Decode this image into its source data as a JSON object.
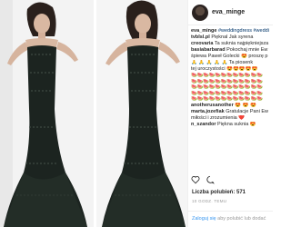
{
  "post": {
    "username": "eva_minge",
    "likes": "Liczba polubień: 571",
    "date": "10 GODZ. TEMU"
  },
  "comments": [
    {
      "user": "eva_minge",
      "text": "#weddingdress #weddi"
    },
    {
      "user": "tvbIsl.pl",
      "text": "Pięknal Jak syrena"
    },
    {
      "user": "creovaria",
      "text": "Ta suknia najpiękniejsza"
    },
    {
      "user": "basiabarbarad",
      "text": "Pokochaj mnie Ew"
    },
    {
      "user": "",
      "text": "śpiewa Paweł Golecki 😍 proszę p"
    },
    {
      "user": "",
      "text": "🙏 🙏 🙏 🙏 🙏 Ta piosenk"
    },
    {
      "user": "",
      "text": "tej uroczystości 😍😍😍😍😍"
    }
  ],
  "emoji_rows": [
    "🍉🍉🍉🍉🍉🍉🍉🍉🍉🍉🍉🍉",
    "🍉🍉🍉🍉🍉🍉🍉🍉🍉🍉🍉🍉",
    "🍉🍉🍉🍉🍉🍉🍉🍉🍉🍉🍉🍉",
    "🍉🍉🍉🍉🍉🍉🍉🍉🍉🍉🍉🍉",
    "🍉🍉🍉🍉🍉🍉🍉🍉🍉🍉🍉🍉"
  ],
  "comments2": [
    {
      "user": "anotherusanother",
      "text": "😍 😍 😍"
    },
    {
      "user": "marta.jozefiak",
      "text": "Gratulacje Pani Ew"
    },
    {
      "user": "",
      "text": "miłości i zrozumienia ❤️"
    },
    {
      "user": "n_szandor",
      "text": "Piękna suknia 😍"
    }
  ],
  "footer": {
    "login": "Zaloguj się",
    "rest": "aby polubić lub dodać"
  },
  "colors": {
    "dress": "#1c2420",
    "background": "#f2f2f2",
    "link": "#3897f0"
  },
  "icons": [
    "heart-icon",
    "comment-icon"
  ]
}
